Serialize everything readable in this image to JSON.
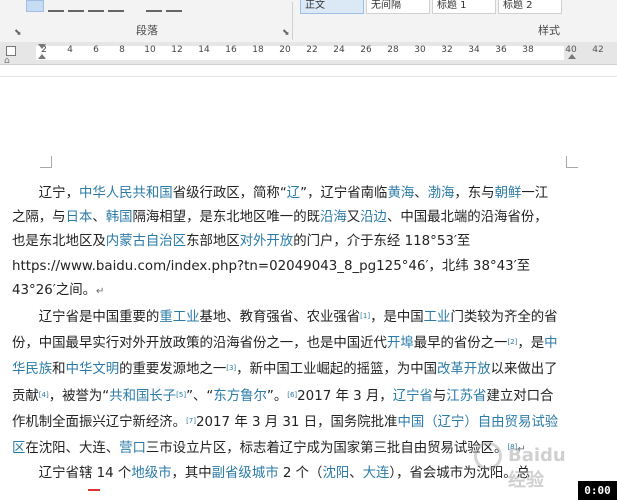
{
  "ribbon": {
    "paragraph_group": "段落",
    "styles_group": "样式",
    "style_boxes": [
      "正文",
      "无间隔",
      "标题 1",
      "标题 2"
    ]
  },
  "ruler": {
    "ticks": [
      "2",
      "4",
      "6",
      "8",
      "10",
      "12",
      "14",
      "16",
      "18",
      "20",
      "22",
      "24",
      "26",
      "28",
      "30",
      "32",
      "34",
      "36",
      "38",
      "40",
      "42"
    ]
  },
  "doc": {
    "p1": {
      "t1": "辽宁，",
      "l1": "中华人民共和国",
      "t2": "省级行政区，简称“",
      "l2": "辽",
      "t3": "”，辽宁省南临",
      "l3": "黄海",
      "t4": "、",
      "l4": "渤海",
      "t5": "，东与",
      "l5": "朝鲜",
      "t6": "一江之隔，与",
      "l6": "日本",
      "t7": "、",
      "l7": "韩国",
      "t8": "隔海相望，是东北地区唯一的既",
      "l8": "沿海",
      "t9": "又",
      "l9": "沿边",
      "t10": "、中国最北端的沿海省份，也是东北地区及",
      "l10": "内蒙古自治区",
      "t11": "东部地区",
      "l11": "对外开放",
      "t12": "的门户，介于东经 118°53′至 https://www.baidu.com/index.php?tn=02049043_8_pg125°46′，北纬 38°43′至 43°26′之间。"
    },
    "p2": {
      "t1": "辽宁省是中国重要的",
      "l1": "重工业",
      "t2": "基地、教育强省、农业强省",
      "s1": "[1]",
      "t3": "，是中国",
      "l2": "工业",
      "t4": "门类较为齐全的省份，中国最早实行对外开放政策的沿海省份之一，也是中国近代",
      "l3": "开埠",
      "t5": "最早的省份之一",
      "s2": "[2]",
      "t6": "，是",
      "l4": "中华民族",
      "t7": "和",
      "l5": "中华文明",
      "t8": "的重要发源地之一",
      "s3": "[3]",
      "t9": "，新中国工业崛起的摇篮，为中国",
      "l6": "改革开放",
      "t10": "以来做出了贡献",
      "s4": "[4]",
      "t11": "，被誉为“",
      "l7": "共和国长子",
      "s5": "[5]",
      "t12": "”、“",
      "l8": "东方鲁尔",
      "t13": "”。",
      "s6": "[6]",
      "t14": "2017 年 3 月，",
      "l9": "辽宁省",
      "t15": "与",
      "l10": "江苏省",
      "t16": "建立对口合作机制全面振兴辽宁新经济。",
      "s7": "[7]",
      "t17": "2017 年 3 月 31 日，国务院批准",
      "l11": "中国（辽宁）自由贸易试验区",
      "t18": "在沈阳、大连、",
      "l12": "营口",
      "t19": "三市设立片区，标志着辽宁成为国家第三批自由贸易试验区。",
      "s8": "[8]"
    },
    "p3": {
      "t1": "辽宁省辖 14 个",
      "l1": "地级市",
      "t2": "，其中",
      "l2": "副省级城市",
      "t3": " 2 个（",
      "l3": "沈阳",
      "t4": "、",
      "l4": "大连",
      "t5": "），省会城市为沈阳。总"
    }
  },
  "watermark": "Baidu 经验",
  "timer": "0:00"
}
